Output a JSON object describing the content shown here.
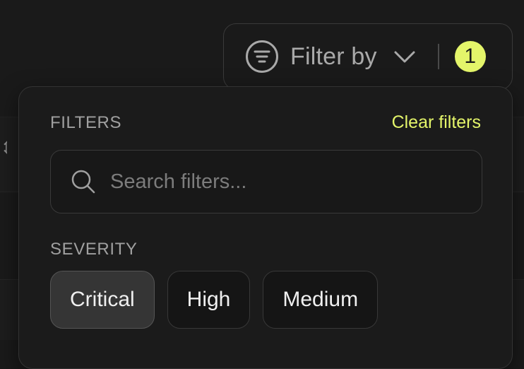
{
  "filter_button": {
    "label": "Filter by",
    "active_count": "1",
    "icon": "filter-lines-icon",
    "dropdown_icon": "chevron-down-icon"
  },
  "panel": {
    "section_title": "FILTERS",
    "clear_label": "Clear filters",
    "search": {
      "placeholder": "Search filters...",
      "value": ""
    },
    "severity": {
      "title": "SEVERITY",
      "options": [
        {
          "label": "Critical",
          "selected": true
        },
        {
          "label": "High",
          "selected": false
        },
        {
          "label": "Medium",
          "selected": false
        }
      ]
    }
  },
  "colors": {
    "accent": "#e4f56a",
    "background": "#1a1a1a",
    "panel": "#1b1b1b",
    "selected_chip": "#353535"
  }
}
